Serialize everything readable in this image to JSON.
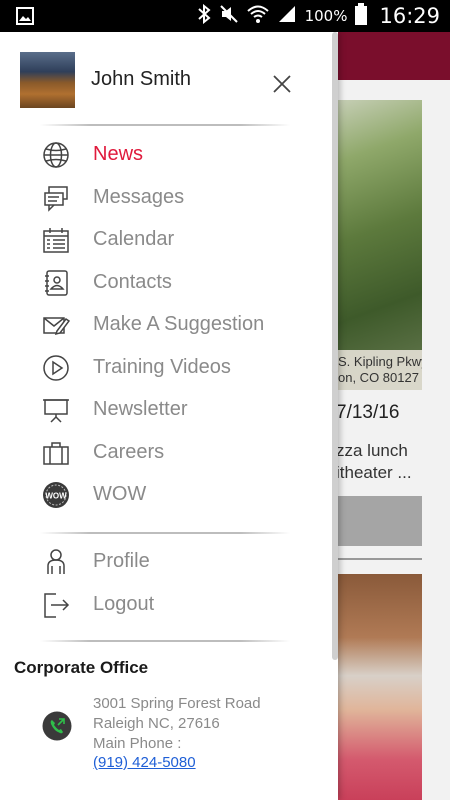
{
  "status_bar": {
    "battery_percent": "100%",
    "time": "16:29",
    "icons": [
      "image-icon",
      "bluetooth-icon",
      "mute-icon",
      "wifi-icon",
      "signal-icon",
      "battery-icon"
    ]
  },
  "background": {
    "caption_line1": "S. Kipling Pkwy",
    "caption_line2": "on, CO 80127",
    "date": "7/13/16",
    "text_line1": "zza lunch",
    "text_line2": "itheater ..."
  },
  "drawer": {
    "user_name": "John Smith",
    "menu": [
      {
        "label": "News",
        "icon": "globe-icon",
        "active": true
      },
      {
        "label": "Messages",
        "icon": "messages-icon"
      },
      {
        "label": "Calendar",
        "icon": "calendar-icon"
      },
      {
        "label": "Contacts",
        "icon": "contacts-icon"
      },
      {
        "label": "Make A Suggestion",
        "icon": "suggestion-icon"
      },
      {
        "label": "Training Videos",
        "icon": "play-icon"
      },
      {
        "label": "Newsletter",
        "icon": "presentation-icon"
      },
      {
        "label": "Careers",
        "icon": "briefcase-icon"
      },
      {
        "label": "WOW",
        "icon": "wow-badge-icon"
      }
    ],
    "account": [
      {
        "label": "Profile",
        "icon": "person-icon"
      },
      {
        "label": "Logout",
        "icon": "logout-icon"
      }
    ],
    "office": {
      "title": "Corporate Office",
      "address_line1": "3001 Spring Forest Road",
      "address_line2": "Raleigh NC, 27616",
      "phone_label": "Main Phone :",
      "phone": "(919) 424-5080"
    }
  },
  "colors": {
    "accent": "#e01a3c",
    "brand_bar": "#7a0e2c",
    "menu_text": "#8a8a8a",
    "link": "#1f5fd6",
    "phone_icon_bg": "#3a3a3a",
    "phone_icon_arrow": "#2fbf4a"
  }
}
